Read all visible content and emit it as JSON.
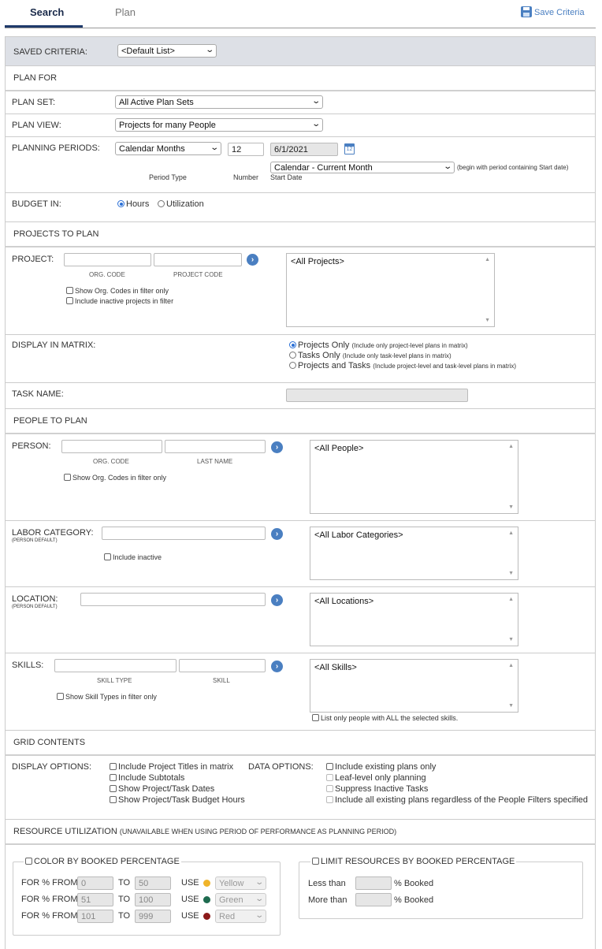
{
  "tabs": {
    "search": "Search",
    "plan": "Plan"
  },
  "save_criteria": "Save Criteria",
  "saved_criteria": {
    "label": "SAVED CRITERIA:",
    "value": "<Default List>"
  },
  "plan_for": {
    "header": "PLAN FOR",
    "plan_set_label": "PLAN SET:",
    "plan_set_value": "All Active Plan Sets",
    "plan_view_label": "PLAN VIEW:",
    "plan_view_value": "Projects for many People",
    "planning_periods_label": "PLANNING PERIODS:",
    "period_type_value": "Calendar Months",
    "number_value": "12",
    "start_date_value": "6/1/2021",
    "period_type_caption": "Period Type",
    "number_caption": "Number",
    "start_date_caption": "Start Date",
    "start_option_value": "Calendar - Current Month",
    "start_option_note": "(begin with period containing Start date)",
    "budget_label": "BUDGET IN:",
    "budget_hours": "Hours",
    "budget_utilization": "Utilization"
  },
  "projects": {
    "header": "PROJECTS TO PLAN",
    "project_label": "PROJECT:",
    "org_code_caption": "ORG. CODE",
    "project_code_caption": "PROJECT CODE",
    "show_org_codes": "Show Org. Codes in filter only",
    "include_inactive": "Include inactive projects in filter",
    "list_value": "<All Projects>",
    "display_label": "DISPLAY IN MATRIX:",
    "opt1": "Projects Only",
    "opt1_note": "(Include only project-level plans in matrix)",
    "opt2": "Tasks Only",
    "opt2_note": "(Include only task-level plans in matrix)",
    "opt3": "Projects and Tasks",
    "opt3_note": "(Include project-level and task-level plans in matrix)",
    "task_name_label": "TASK NAME:"
  },
  "people": {
    "header": "PEOPLE TO PLAN",
    "person_label": "PERSON:",
    "org_code_caption": "ORG. CODE",
    "last_name_caption": "LAST NAME",
    "show_org_codes": "Show Org. Codes in filter only",
    "person_list": "<All People>",
    "labor_label": "LABOR CATEGORY:",
    "person_default": "(PERSON DEFAULT)",
    "include_inactive": "Include inactive",
    "labor_list": "<All Labor Categories>",
    "location_label": "LOCATION:",
    "location_list": "<All Locations>",
    "skills_label": "SKILLS:",
    "skill_type_caption": "SKILL TYPE",
    "skill_caption": "SKILL",
    "show_skill_types": "Show Skill Types in filter only",
    "skills_list": "<All Skills>",
    "list_all_skills": "List only people with ALL the selected skills."
  },
  "grid": {
    "header": "GRID CONTENTS",
    "display_label": "DISPLAY OPTIONS:",
    "display_opts": [
      "Include Project Titles in matrix",
      "Include Subtotals",
      "Show Project/Task Dates",
      "Show Project/Task Budget Hours"
    ],
    "data_label": "DATA OPTIONS:",
    "data_opts": [
      "Include existing plans only",
      "Leaf-level only planning",
      "Suppress Inactive Tasks",
      "Include all existing plans regardless of the People Filters specified"
    ]
  },
  "resource": {
    "header": "RESOURCE UTILIZATION",
    "header_note": "(UNAVAILABLE WHEN USING PERIOD OF PERFORMANCE AS PLANNING PERIOD)",
    "color_legend": "COLOR BY BOOKED PERCENTAGE",
    "for_label": "FOR % FROM",
    "to_label": "TO",
    "use_label": "USE",
    "rows": [
      {
        "from": "0",
        "to": "50",
        "color_name": "Yellow",
        "color": "#f0b429"
      },
      {
        "from": "51",
        "to": "100",
        "color_name": "Green",
        "color": "#1e6b4f"
      },
      {
        "from": "101",
        "to": "999",
        "color_name": "Red",
        "color": "#8b1a1a"
      }
    ],
    "limit_legend": "LIMIT RESOURCES BY BOOKED PERCENTAGE",
    "less_than": "Less than",
    "more_than": "More than",
    "booked": "% Booked"
  },
  "colors": {
    "accent": "#4a7fc1",
    "tab_underline": "#1f3a6b",
    "header_bar": "#dde0e6"
  }
}
